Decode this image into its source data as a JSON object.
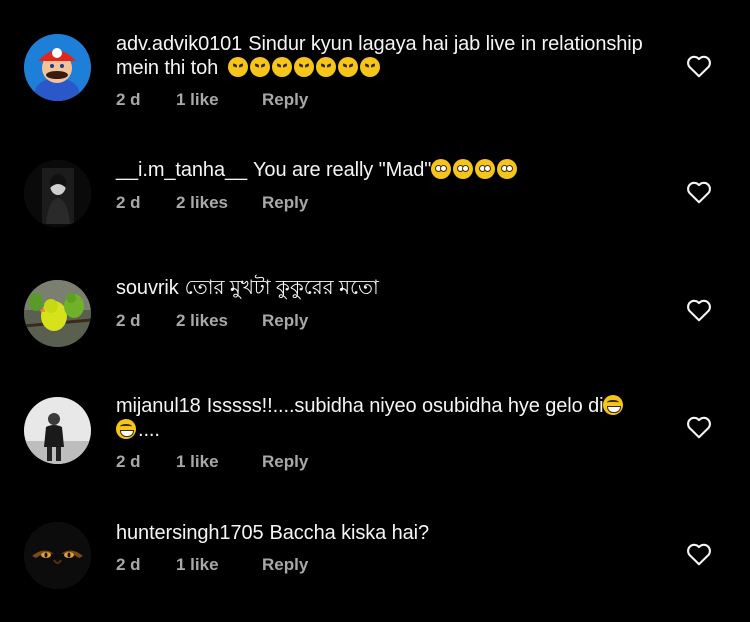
{
  "comments": [
    {
      "username": "adv.advik0101",
      "line1": "Sindur kyun lagaya hai jab live in relationship",
      "line2": "mein thi toh",
      "age": "2 d",
      "likes": "1 like",
      "reply": "Reply",
      "avatar_icon": "mario-avatar"
    },
    {
      "username": "__i.m_tanha__",
      "line1": "You are really \"Mad\"",
      "age": "2 d",
      "likes": "2 likes",
      "reply": "Reply",
      "avatar_icon": "person-photo-avatar"
    },
    {
      "username": "souvrik",
      "line1": "তোর মুখটা কুকুরের মতো",
      "age": "2 d",
      "likes": "2 likes",
      "reply": "Reply",
      "avatar_icon": "parrots-avatar"
    },
    {
      "username": "mijanul18",
      "line1": "Isssss!!....subidha  niyeo osubidha hye gelo di",
      "line2": "....",
      "age": "2 d",
      "likes": "1 like",
      "reply": "Reply",
      "avatar_icon": "person-photo-avatar"
    },
    {
      "username": "huntersingh1705",
      "line1": "Baccha kiska hai?",
      "age": "2 d",
      "likes": "1 like",
      "reply": "Reply",
      "avatar_icon": "tiger-eyes-avatar"
    }
  ],
  "colors": {
    "background": "#000000",
    "text": "#f5f5f5",
    "meta": "#a8a8a8"
  }
}
